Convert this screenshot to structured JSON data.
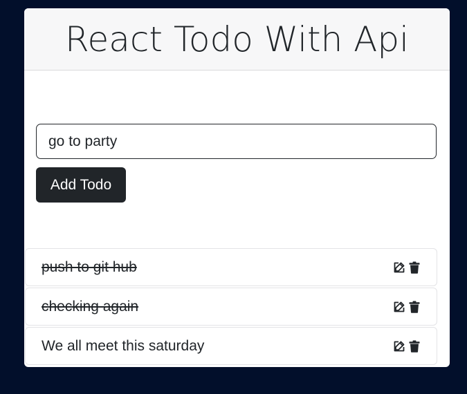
{
  "app": {
    "title": "React Todo With Api"
  },
  "form": {
    "input_value": "go to party",
    "add_button_label": "Add Todo"
  },
  "todos": [
    {
      "text": "push to git hub",
      "completed": true,
      "edit_icon": "edit-icon",
      "delete_icon": "trash-icon"
    },
    {
      "text": "checking again",
      "completed": true,
      "edit_icon": "edit-icon",
      "delete_icon": "trash-icon"
    },
    {
      "text": "We all meet this saturday",
      "completed": false,
      "edit_icon": "edit-icon",
      "delete_icon": "trash-icon"
    }
  ],
  "colors": {
    "page_background": "#020f2b",
    "card_background": "#ffffff",
    "header_background": "#f7f7f8",
    "text": "#212529",
    "button_background": "#212529",
    "button_text": "#ffffff"
  }
}
